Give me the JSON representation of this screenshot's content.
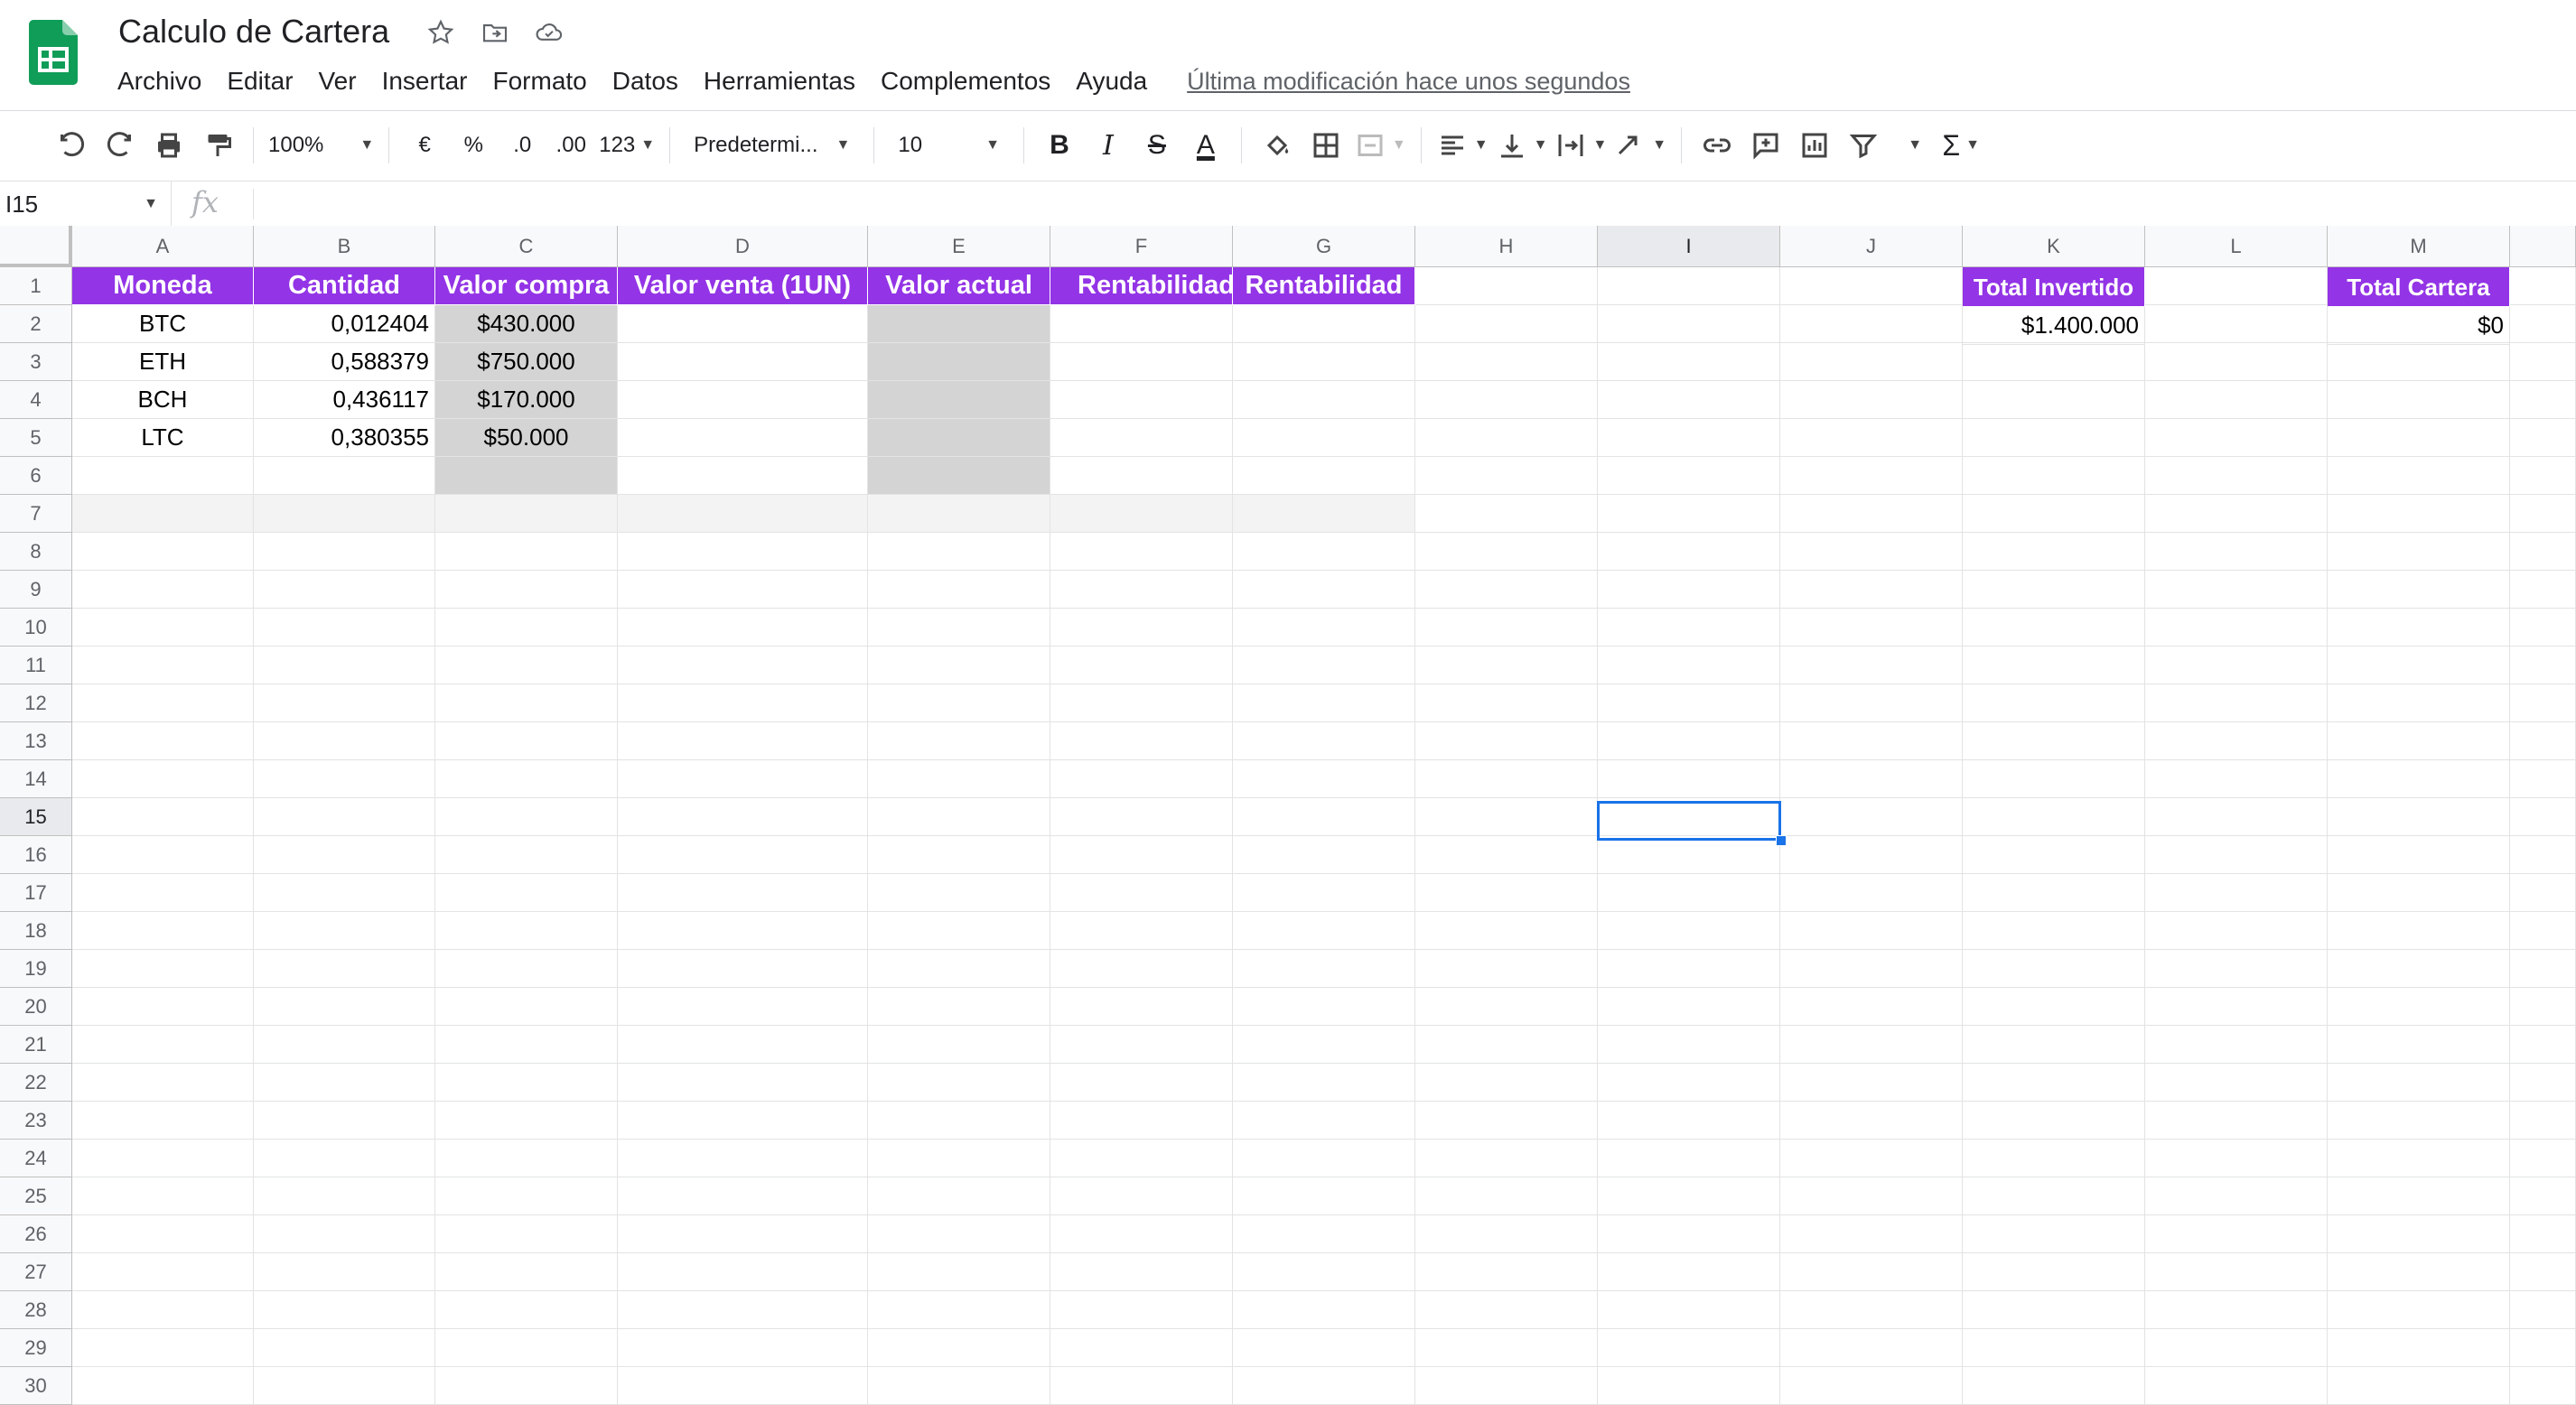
{
  "app": {
    "title": "Calculo de Cartera",
    "last_edit": "Última modificación hace unos segundos",
    "menu": [
      "Archivo",
      "Editar",
      "Ver",
      "Insertar",
      "Formato",
      "Datos",
      "Herramientas",
      "Complementos",
      "Ayuda"
    ]
  },
  "toolbar": {
    "zoom": "100%",
    "currency": "€",
    "percent": "%",
    "dec_less": ".0",
    "dec_more": ".00",
    "format_more": "123",
    "font": "Predetermi...",
    "font_size": "10",
    "bold": "B",
    "italic": "I",
    "strike": "S",
    "text_color": "A",
    "sum": "Σ"
  },
  "formula_bar": {
    "name_box": "I15",
    "fx": "fx",
    "content": ""
  },
  "columns": [
    "A",
    "B",
    "C",
    "D",
    "E",
    "F",
    "G",
    "H",
    "I",
    "J",
    "K",
    "L",
    "M"
  ],
  "rows": [
    "1",
    "2",
    "3",
    "4",
    "5",
    "6",
    "7",
    "8",
    "9",
    "10",
    "11",
    "12",
    "13",
    "14",
    "15",
    "16",
    "17",
    "18",
    "19",
    "20",
    "21",
    "22",
    "23",
    "24",
    "25",
    "26",
    "27",
    "28",
    "29",
    "30"
  ],
  "table": {
    "headers": [
      "Moneda",
      "Cantidad",
      "Valor compra",
      "Valor venta (1UN)",
      "Valor actual",
      "Rentabilidad Bruta",
      "Rentabilidad"
    ],
    "rows": [
      {
        "moneda": "BTC",
        "cantidad": "0,012404",
        "compra": "$430.000"
      },
      {
        "moneda": "ETH",
        "cantidad": "0,588379",
        "compra": "$750.000"
      },
      {
        "moneda": "BCH",
        "cantidad": "0,436117",
        "compra": "$170.000"
      },
      {
        "moneda": "LTC",
        "cantidad": "0,380355",
        "compra": "$50.000"
      }
    ]
  },
  "summary": {
    "total_invertido_label": "Total Invertido",
    "total_invertido_value": "$1.400.000",
    "total_cartera_label": "Total Cartera",
    "total_cartera_value": "$0"
  },
  "colors": {
    "header_purple": "#9334e6",
    "gray_fill": "#d4d4d4",
    "selection": "#1a73e8",
    "sheets_green": "#0f9d58"
  },
  "selected_cell": "I15"
}
